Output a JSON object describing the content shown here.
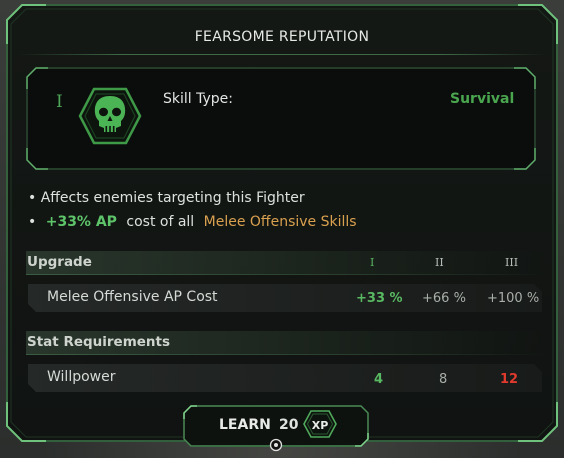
{
  "title": "FEARSOME REPUTATION",
  "skill": {
    "tier": "I",
    "type_label": "Skill Type:",
    "type_value": "Survival",
    "icon": "skull-icon",
    "accent_color": "#4aa54f"
  },
  "description": {
    "line1": "• Affects enemies targeting this Fighter",
    "line2_bullet": "•",
    "line2_highlight": "+33% AP",
    "line2_mid": "cost of all",
    "line2_skills": "Melee Offensive Skills"
  },
  "upgrade": {
    "header": "Upgrade",
    "tiers": [
      "I",
      "II",
      "III"
    ],
    "row": {
      "label": "Melee Offensive AP Cost",
      "values": [
        "+33 %",
        "+66 %",
        "+100 %"
      ]
    }
  },
  "requirements": {
    "header": "Stat Requirements",
    "row": {
      "label": "Willpower",
      "values": [
        "4",
        "8",
        "12"
      ],
      "value_colors": [
        "#59b862",
        "#a9aea9",
        "#e03a2e"
      ]
    }
  },
  "learn": {
    "label": "LEARN",
    "cost": "20",
    "currency": "XP"
  }
}
